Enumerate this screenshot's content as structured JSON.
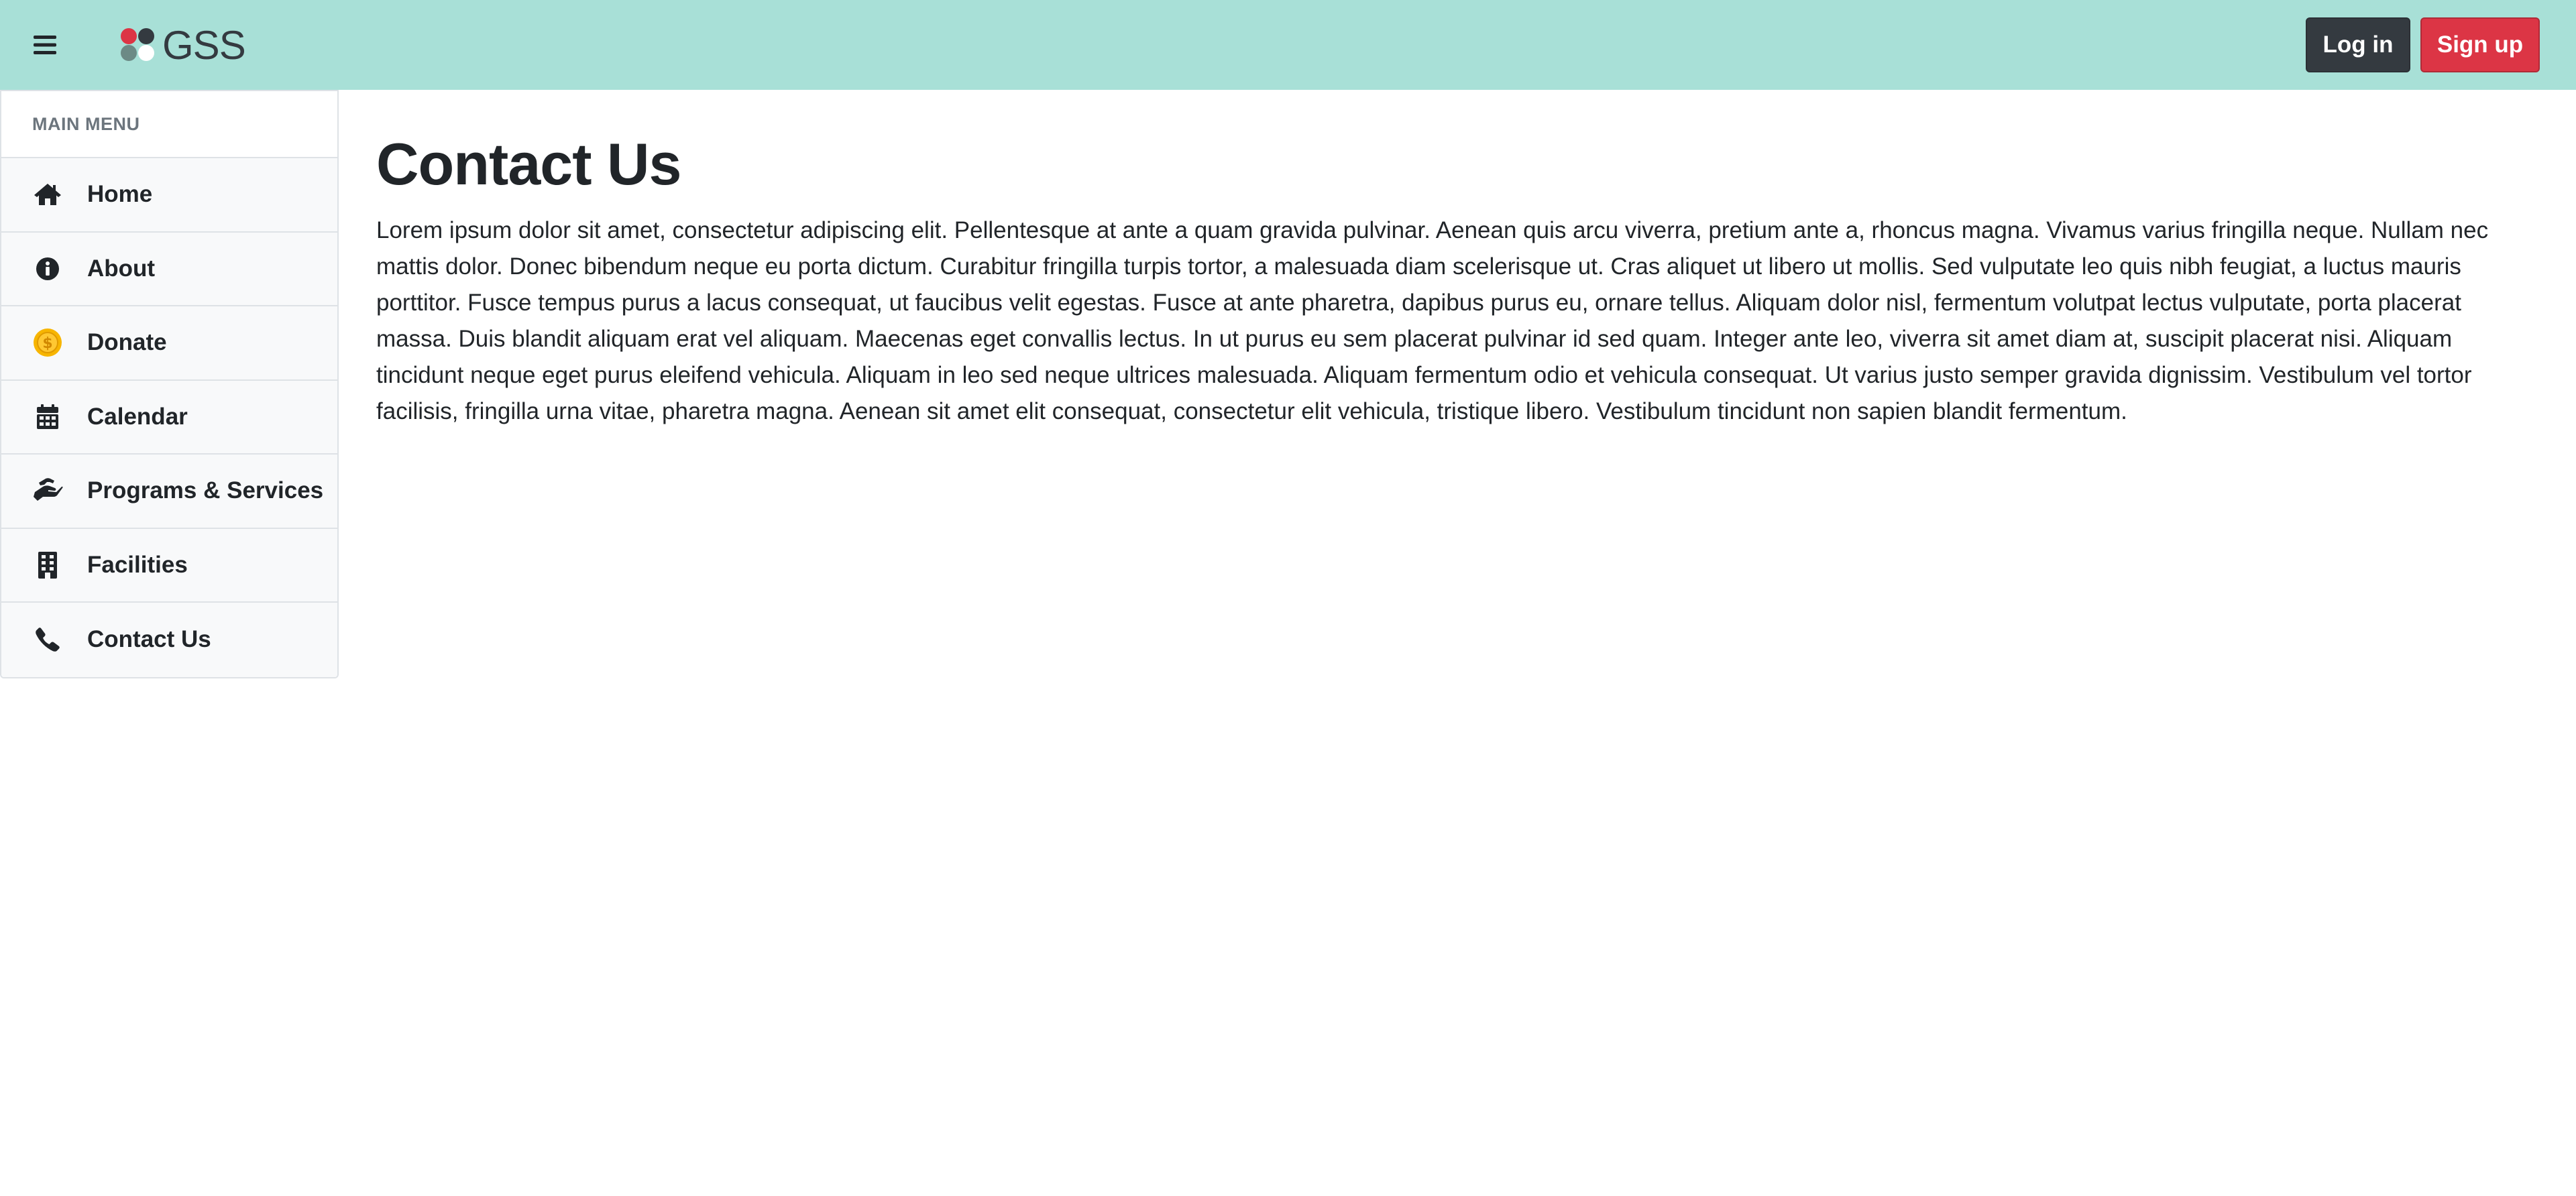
{
  "header": {
    "brand_name": "GSS",
    "login_label": "Log in",
    "signup_label": "Sign up",
    "menu_icon": "hamburger-icon",
    "logo_colors": [
      "#dc3545",
      "#343a40",
      "#6c8a85",
      "#ffffff"
    ]
  },
  "sidebar": {
    "title": "MAIN MENU",
    "items": [
      {
        "label": "Home",
        "icon": "home-icon"
      },
      {
        "label": "About",
        "icon": "info-icon"
      },
      {
        "label": "Donate",
        "icon": "coin-icon"
      },
      {
        "label": "Calendar",
        "icon": "calendar-icon"
      },
      {
        "label": "Programs & Services",
        "icon": "hand-holding-icon"
      },
      {
        "label": "Facilities",
        "icon": "building-icon"
      },
      {
        "label": "Contact Us",
        "icon": "phone-icon"
      }
    ]
  },
  "main": {
    "title": "Contact Us",
    "body": "Lorem ipsum dolor sit amet, consectetur adipiscing elit. Pellentesque at ante a quam gravida pulvinar. Aenean quis arcu viverra, pretium ante a, rhoncus magna. Vivamus varius fringilla neque. Nullam nec mattis dolor. Donec bibendum neque eu porta dictum. Curabitur fringilla turpis tortor, a malesuada diam scelerisque ut. Cras aliquet ut libero ut mollis. Sed vulputate leo quis nibh feugiat, a luctus mauris porttitor. Fusce tempus purus a lacus consequat, ut faucibus velit egestas. Fusce at ante pharetra, dapibus purus eu, ornare tellus. Aliquam dolor nisl, fermentum volutpat lectus vulputate, porta placerat massa. Duis blandit aliquam erat vel aliquam. Maecenas eget convallis lectus. In ut purus eu sem placerat pulvinar id sed quam. Integer ante leo, viverra sit amet diam at, suscipit placerat nisi. Aliquam tincidunt neque eget purus eleifend vehicula. Aliquam in leo sed neque ultrices malesuada. Aliquam fermentum odio et vehicula consequat. Ut varius justo semper gravida dignissim. Vestibulum vel tortor facilisis, fringilla urna vitae, pharetra magna. Aenean sit amet elit consequat, consectetur elit vehicula, tristique libero. Vestibulum tincidunt non sapien blandit fermentum."
  },
  "colors": {
    "navbar": "#a8e0d7",
    "login_button": "#343a40",
    "signup_button": "#dc3545",
    "donate_coin": "#f7b500"
  }
}
